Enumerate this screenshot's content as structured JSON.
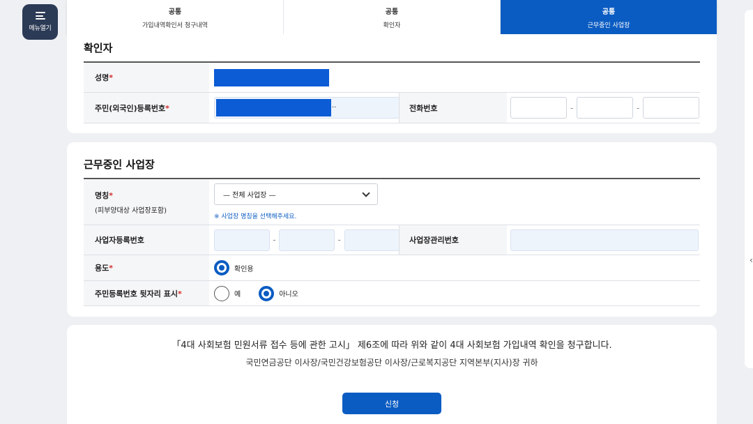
{
  "menu": {
    "label": "메뉴열기"
  },
  "steps": [
    {
      "top": "공통",
      "label": "가입내역확인서 청구내역"
    },
    {
      "top": "공통",
      "label": "확인자"
    },
    {
      "top": "공통",
      "label": "근무중인 사업장"
    }
  ],
  "verifier": {
    "title": "확인자",
    "name_label": "성명",
    "rrn_label": "주민(외국인)등록번호",
    "rrn_suffix": "··",
    "phone_label": "전화번호",
    "required_mark": "*"
  },
  "workplace": {
    "title": "근무중인 사업장",
    "name_label": "명칭",
    "name_sub": "(피부양대상 사업장포함)",
    "select_value": "— 전체 사업장 —",
    "hint": "※ 사업장 명칭을 선택해주세요.",
    "bizno_label": "사업자등록번호",
    "mgmt_label": "사업장관리번호",
    "purpose_label": "용도",
    "purpose_option": "확인용",
    "rrn_show_label": "주민등록번호 뒷자리 표시",
    "yes": "예",
    "no": "아니오",
    "required_mark": "*",
    "dash": "-"
  },
  "notice": {
    "line1": "「4대 사회보험 민원서류 접수 등에 관한 고시」 제6조에 따라 위와 같이 4대 사회보험 가입내역 확인을 청구합니다.",
    "line2": "국민연금공단 이사장/국민건강보험공단 이사장/근로복지공단 지역본부(지사)장 귀하"
  },
  "submit_label": "신청",
  "colors": {
    "primary": "#0b5cc2",
    "menu_bg": "#2b3a55",
    "required": "#d42b2b"
  }
}
